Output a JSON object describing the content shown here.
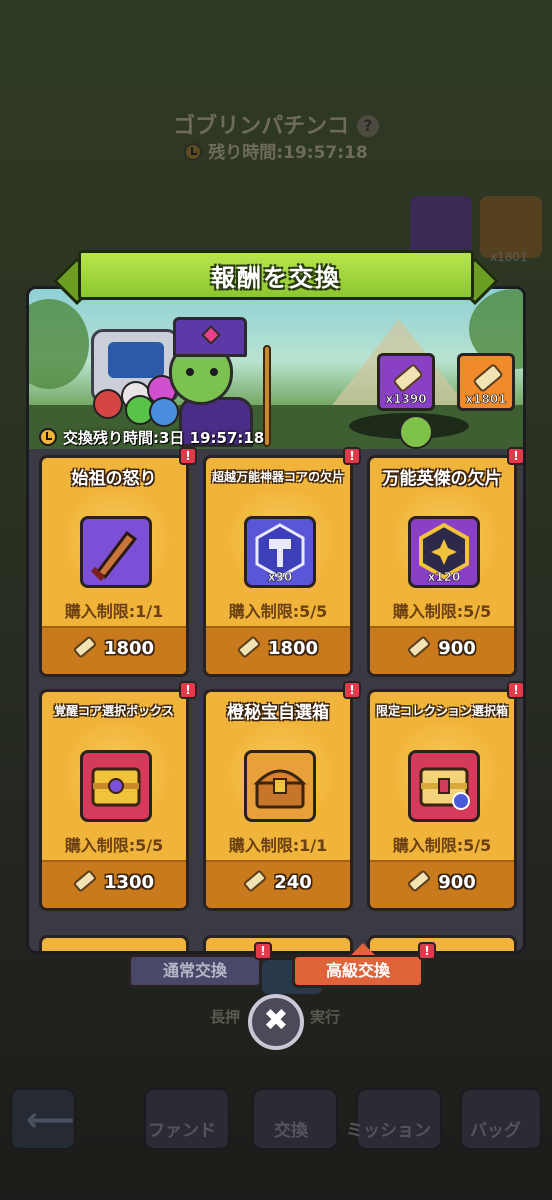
{
  "background": {
    "title": "ゴブリンパチンコ",
    "help_glyph": "?",
    "remaining_label": "残り時間",
    "remaining_time": "19:57:18",
    "currency_right_count": "x1801",
    "hint_left": "長押",
    "hint_right": "実行",
    "bottom_nav": [
      {
        "label": "ファンド"
      },
      {
        "label": "交換"
      },
      {
        "label": "ミッション"
      },
      {
        "label": "バッグ"
      }
    ]
  },
  "modal": {
    "title": "報酬を交換",
    "exchange_timer": "交換残り時間:3日 19:57:18",
    "currencies": [
      {
        "name": "scroll-purple",
        "amount": "x1390",
        "color": "#8a3fc7"
      },
      {
        "name": "scroll-orange",
        "amount": "x1801",
        "color": "#f08a2a"
      }
    ],
    "items": [
      {
        "name": "始祖の怒り",
        "limit": "購入制限:1/1",
        "price": "1800",
        "qty": "",
        "icon": "weapon-icon",
        "box_color": "#7b4fd6",
        "badge": "!"
      },
      {
        "name": "超越万能神器コアの欠片",
        "limit": "購入制限:5/5",
        "price": "1800",
        "qty": "x30",
        "icon": "hammer-core-icon",
        "box_color": "#5a56d8",
        "badge": "!"
      },
      {
        "name": "万能英傑の欠片",
        "limit": "購入制限:5/5",
        "price": "900",
        "qty": "x120",
        "icon": "hero-shard-icon",
        "box_color": "#8a3fc7",
        "badge": "!"
      },
      {
        "name": "覚醒コア選択ボックス",
        "limit": "購入制限:5/5",
        "price": "1300",
        "qty": "",
        "icon": "core-chest-icon",
        "box_color": "#d63a5a",
        "badge": "!"
      },
      {
        "name": "橙秘宝自選箱",
        "limit": "購入制限:1/1",
        "price": "240",
        "qty": "",
        "icon": "treasure-chest-icon",
        "box_color": "#e8a13a",
        "badge": "!"
      },
      {
        "name": "限定コレクション選択箱",
        "limit": "購入制限:5/5",
        "price": "900",
        "qty": "",
        "icon": "collection-chest-icon",
        "box_color": "#d63a5a",
        "badge": "!"
      }
    ]
  },
  "tabs": {
    "normal_label": "通常交換",
    "premium_label": "高級交換",
    "normal_badge": "!",
    "premium_badge": "!"
  },
  "close_glyph": "✖"
}
